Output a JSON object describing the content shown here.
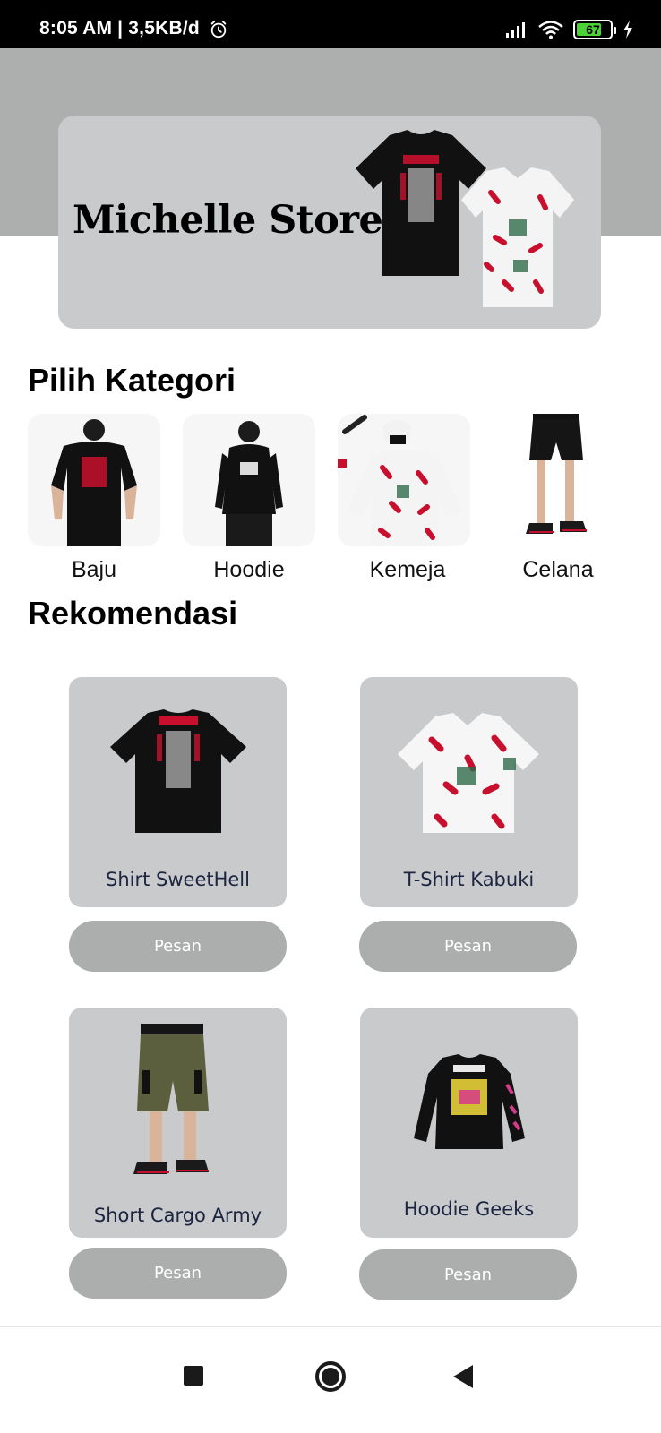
{
  "status_bar": {
    "time": "8:05 AM | 3,5KB/d",
    "battery": "67",
    "icons": [
      "alarm-icon",
      "signal-icon",
      "wifi-icon",
      "battery-icon",
      "charging-icon"
    ]
  },
  "banner": {
    "store_name": "Michelle Store",
    "background": "#c9cacc",
    "header_color": "#adaeae"
  },
  "categories": {
    "title": "Pilih Kategori",
    "items": [
      {
        "label": "Baju"
      },
      {
        "label": "Hoodie"
      },
      {
        "label": "Kemeja"
      },
      {
        "label": "Celana"
      }
    ]
  },
  "recommendations": {
    "title": "Rekomendasi",
    "items": [
      {
        "name": "Shirt SweetHell",
        "button": "Pesan"
      },
      {
        "name": "T-Shirt Kabuki",
        "button": "Pesan"
      },
      {
        "name": "Short Cargo Army",
        "button": "Pesan"
      },
      {
        "name": "Hoodie Geeks",
        "button": "Pesan"
      }
    ],
    "card_color": "#c9cacc",
    "button_color": "#acadad"
  },
  "nav_bar": {
    "icons": [
      "recents-icon",
      "home-icon",
      "back-icon"
    ]
  }
}
